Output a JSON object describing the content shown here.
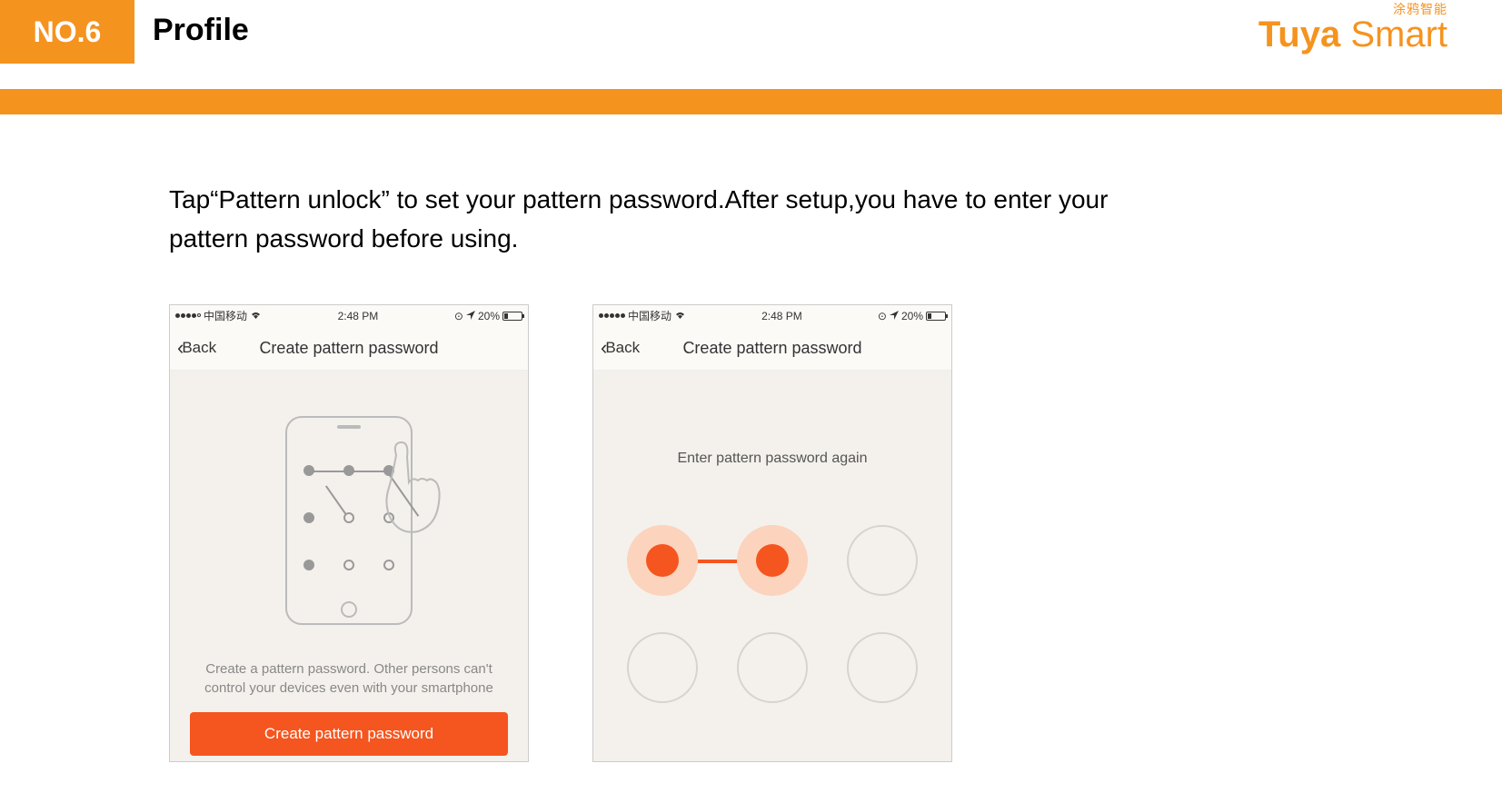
{
  "header": {
    "badge": "NO.6",
    "title": "Profile",
    "logo_cn": "涂鸦智能",
    "logo_bold": "Tuya",
    "logo_light": " Smart"
  },
  "instruction": "Tap“Pattern unlock” to set your pattern password.After setup,you have to enter your pattern password before using.",
  "status_bar": {
    "carrier": "中国移动",
    "time": "2:48 PM",
    "battery_pct": "20%"
  },
  "phone1": {
    "back_label": "Back",
    "nav_title": "Create pattern password",
    "description": "Create a pattern password. Other persons can't control your devices even with your smartphone",
    "button_label": "Create pattern password"
  },
  "phone2": {
    "back_label": "Back",
    "nav_title": "Create pattern password",
    "instruction": "Enter pattern password again"
  }
}
